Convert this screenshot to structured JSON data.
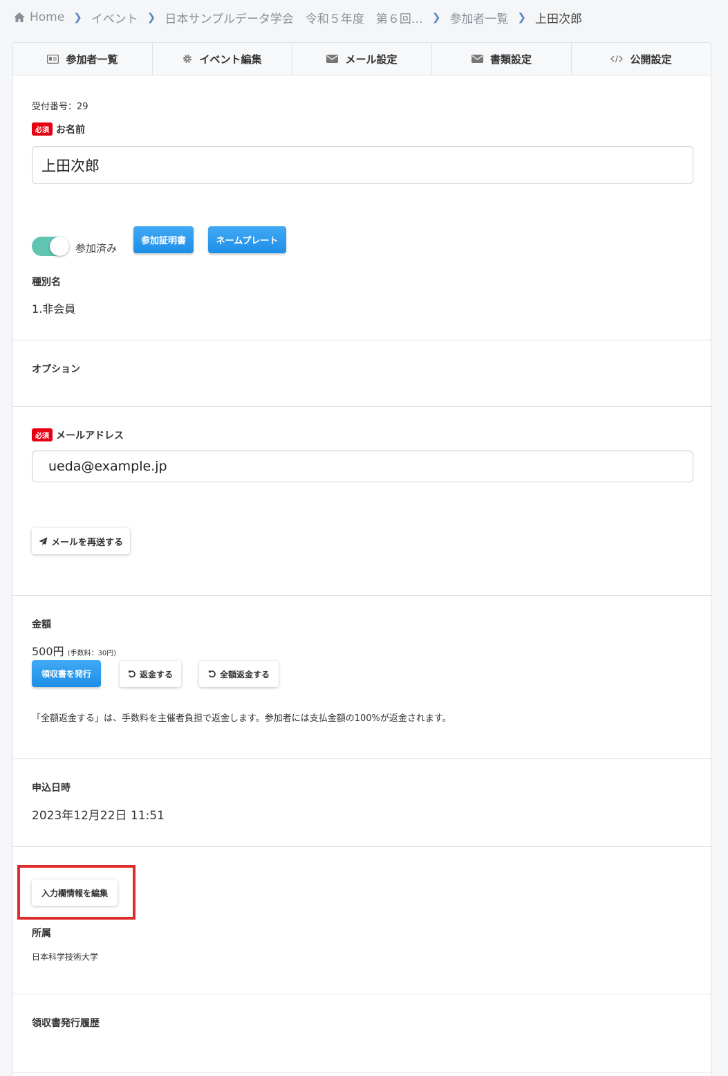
{
  "breadcrumb": {
    "home": "Home",
    "items": [
      "イベント",
      "日本サンプルデータ学会　令和５年度　第６回…",
      "参加者一覧"
    ],
    "current": "上田次郎"
  },
  "tabs": [
    {
      "label": "参加者一覧",
      "icon": "id-card-icon"
    },
    {
      "label": "イベント編集",
      "icon": "gear-icon"
    },
    {
      "label": "メール設定",
      "icon": "envelope-icon"
    },
    {
      "label": "書類設定",
      "icon": "envelope-icon"
    },
    {
      "label": "公開設定",
      "icon": "code-icon"
    }
  ],
  "required_badge": "必須",
  "receipt": {
    "label": "受付番号：",
    "value": "29"
  },
  "name": {
    "label": "お名前",
    "value": "上田次郎"
  },
  "attendance": {
    "toggle_on": true,
    "label": "参加済み",
    "certificate_button": "参加証明書",
    "nameplate_button": "ネームプレート"
  },
  "category": {
    "label": "種別名",
    "value": "1.非会員"
  },
  "options": {
    "label": "オプション"
  },
  "email": {
    "label": "メールアドレス",
    "value": "ueda@example.jp",
    "resend_button": "メールを再送する"
  },
  "amount": {
    "label": "金額",
    "value": "500円",
    "fee": "(手数料：30円)",
    "issue_receipt_button": "領収書を発行",
    "refund_button": "返金する",
    "full_refund_button": "全額返金する",
    "note": "「全額返金する」は、手数料を主催者負担で返金します。参加者には支払金額の100%が返金されます。"
  },
  "application_date": {
    "label": "申込日時",
    "value": "2023年12月22日 11:51"
  },
  "custom_fields": {
    "edit_button": "入力欄情報を編集",
    "affiliation_label": "所属",
    "affiliation_value": "日本科学技術大学"
  },
  "receipt_history": {
    "label": "領収書発行履歴"
  },
  "colors": {
    "accent_blue": "#2196f3",
    "toggle_teal": "#5fc4b0",
    "required_red": "#e60012",
    "highlight_red": "#e02b2b"
  }
}
